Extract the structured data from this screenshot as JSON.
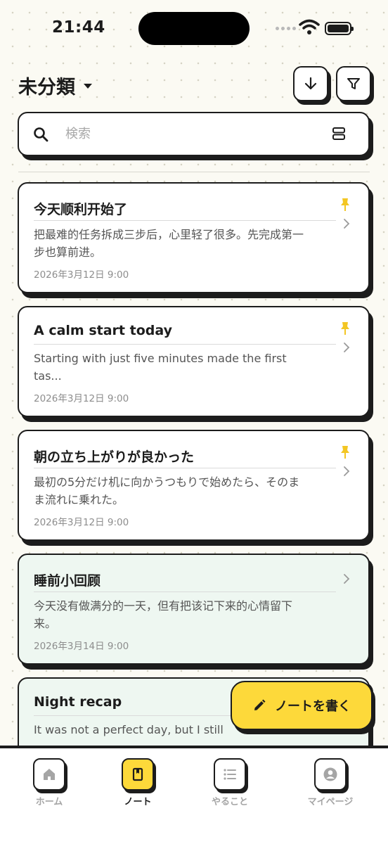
{
  "status_bar": {
    "time": "21:44"
  },
  "header": {
    "title": "未分類"
  },
  "search": {
    "placeholder": "検索"
  },
  "notes": [
    {
      "title": "今天顺利开始了",
      "body_lines": [
        "把最难的任务拆成三步后，心里轻了很多。先完成第一",
        "步也算前进。"
      ],
      "date": "2026年3月12日 9:00",
      "pinned": true,
      "tint": "white"
    },
    {
      "title": "A calm start today",
      "body_lines": [
        "Starting with just five minutes made the first",
        "tas..."
      ],
      "date": "2026年3月12日 9:00",
      "pinned": true,
      "tint": "white"
    },
    {
      "title": "朝の立ち上がりが良かった",
      "body_lines": [
        "最初の5分だけ机に向かうつもりで始めたら、そのま",
        "ま流れに乗れた。"
      ],
      "date": "2026年3月12日 9:00",
      "pinned": true,
      "tint": "white"
    },
    {
      "title": "睡前小回顾",
      "body_lines": [
        "今天没有做满分的一天，但有把该记下来的心情留下",
        "来。"
      ],
      "date": "2026年3月14日 9:00",
      "pinned": false,
      "tint": "mint"
    },
    {
      "title": "Night recap",
      "body_lines": [
        "It was not a perfect day, but I still"
      ],
      "date": "",
      "pinned": false,
      "tint": "mint"
    }
  ],
  "fab": {
    "label": "ノートを書く"
  },
  "tabs": [
    {
      "label": "ホーム",
      "icon": "home-icon",
      "active": false
    },
    {
      "label": "ノート",
      "icon": "notebook-icon",
      "active": true
    },
    {
      "label": "やること",
      "icon": "list-icon",
      "active": false
    },
    {
      "label": "マイページ",
      "icon": "user-icon",
      "active": false
    }
  ],
  "colors": {
    "accent": "#fdd93a",
    "ink": "#1c1c1c",
    "pin": "#f3c623",
    "mint": "#eef7f1"
  }
}
